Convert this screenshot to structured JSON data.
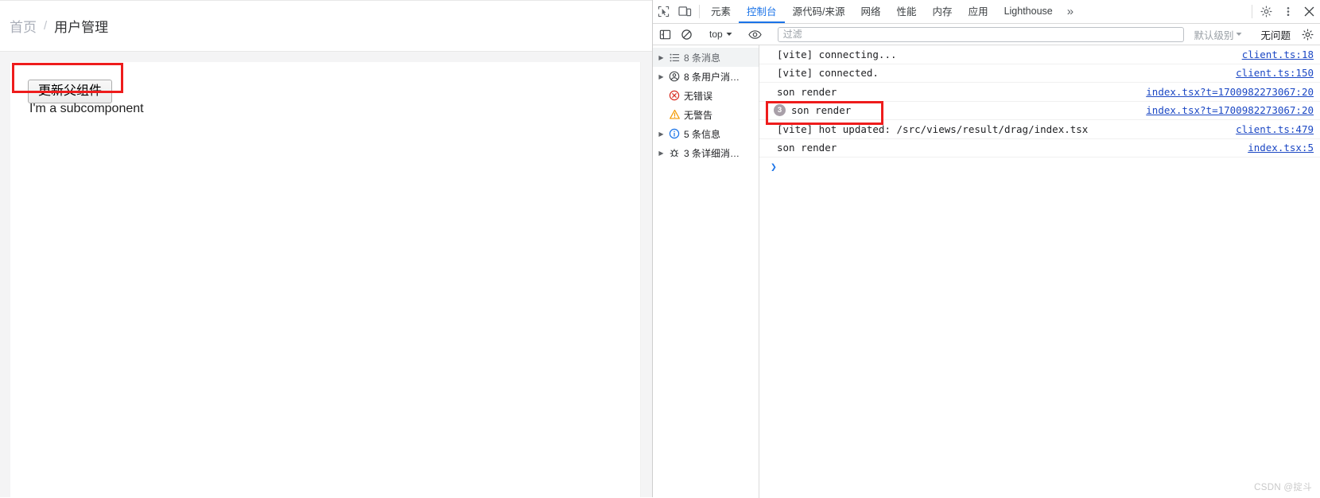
{
  "webpage": {
    "breadcrumb": {
      "home": "首页",
      "separator": "/",
      "current": "用户管理"
    },
    "button_label": "更新父组件",
    "subcomponent_text": "I'm a subcomponent"
  },
  "devtools": {
    "tabs": [
      {
        "label": "元素",
        "active": false
      },
      {
        "label": "控制台",
        "active": true
      },
      {
        "label": "源代码/来源",
        "active": false
      },
      {
        "label": "网络",
        "active": false
      },
      {
        "label": "性能",
        "active": false
      },
      {
        "label": "内存",
        "active": false
      },
      {
        "label": "应用",
        "active": false
      },
      {
        "label": "Lighthouse",
        "active": false
      }
    ],
    "more_tabs_glyph": "»",
    "toolbar": {
      "context_value": "top",
      "filter_placeholder": "过滤",
      "filter_value": "",
      "level_label": "默认级别",
      "issues_label": "无问题"
    },
    "sidebar": [
      {
        "icon": "list-icon",
        "label": "8 条消息",
        "expandable": true,
        "selected": true
      },
      {
        "icon": "user-icon",
        "label": "8 条用户消…",
        "expandable": true,
        "selected": false
      },
      {
        "icon": "error-icon",
        "label": "无错误",
        "expandable": false,
        "selected": false
      },
      {
        "icon": "warning-icon",
        "label": "无警告",
        "expandable": false,
        "selected": false
      },
      {
        "icon": "info-icon",
        "label": "5 条信息",
        "expandable": true,
        "selected": false
      },
      {
        "icon": "verbose-icon",
        "label": "3 条详细消…",
        "expandable": true,
        "selected": false
      }
    ],
    "console_logs": [
      {
        "badge": "",
        "text": "[vite] connecting...",
        "source": "client.ts:18"
      },
      {
        "badge": "",
        "text": "[vite] connected.",
        "source": "client.ts:150"
      },
      {
        "badge": "",
        "text": "son render",
        "source": "index.tsx?t=1700982273067:20"
      },
      {
        "badge": "3",
        "text": "son render",
        "source": "index.tsx?t=1700982273067:20"
      },
      {
        "badge": "",
        "text": "[vite] hot updated: /src/views/result/drag/index.tsx",
        "source": "client.ts:479"
      },
      {
        "badge": "",
        "text": "son render",
        "source": "index.tsx:5"
      }
    ],
    "prompt_glyph": "❯"
  },
  "watermark": "CSDN @掟斗",
  "colors": {
    "accent": "#1a73e8",
    "annotation": "#ee1c1c",
    "link": "#1c48c4",
    "error": "#d93025",
    "warning": "#f29900",
    "info": "#1a73e8"
  }
}
